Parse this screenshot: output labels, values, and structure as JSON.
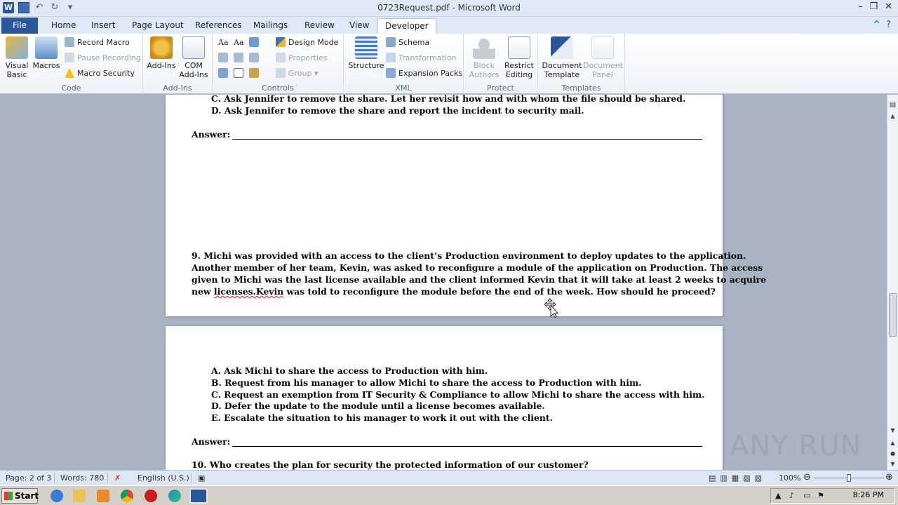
{
  "window": {
    "title": "0723Request.pdf - Microsoft Word",
    "app_icon": "W"
  },
  "tabs": [
    "File",
    "Home",
    "Insert",
    "Page Layout",
    "References",
    "Mailings",
    "Review",
    "View",
    "Developer"
  ],
  "ribbon": {
    "code": {
      "label": "Code",
      "visual_basic": "Visual Basic",
      "macros": "Macros",
      "record_macro": "Record Macro",
      "pause_recording": "Pause Recording",
      "macro_security": "Macro Security"
    },
    "addins": {
      "label": "Add-Ins",
      "add_ins": "Add-Ins",
      "com_add_ins": "COM Add-Ins"
    },
    "controls": {
      "label": "Controls",
      "design_mode": "Design Mode",
      "properties": "Properties",
      "group": "Group"
    },
    "xml": {
      "label": "XML",
      "structure": "Structure",
      "schema": "Schema",
      "transformation": "Transformation",
      "expansion_packs": "Expansion Packs"
    },
    "protect": {
      "label": "Protect",
      "block_authors": "Block Authors",
      "restrict_editing": "Restrict Editing"
    },
    "templates": {
      "label": "Templates",
      "document_template": "Document Template",
      "document_panel": "Document Panel"
    }
  },
  "document": {
    "page1": {
      "option_c": "C.  Ask Jennifer to remove the share. Let her revisit how and with whom the file should be shared.",
      "option_d": "D.  Ask Jennifer to remove the share and report the incident to security mail.",
      "answer_label": "Answer:",
      "q9_lines": [
        "9.  Michi was provided with an access to the client’s Production environment to deploy updates to the application.",
        "Another member of her team, Kevin, was asked to reconfigure a module of the application on Production. The access",
        "given to Michi was the last license available and the client informed Kevin that it will take at least 2 weeks to acquire"
      ],
      "q9_last_prefix": "new ",
      "q9_last_misspelled": "licenses.Kevin",
      "q9_last_suffix": " was told to reconfigure the module before the end of the week. How should he proceed?"
    },
    "page2": {
      "options": [
        "A.  Ask Michi to share the access to Production with him.",
        "B.  Request from his manager to allow Michi to share the access to Production with him.",
        "C.  Request an exemption from IT Security & Compliance to allow Michi to share the access with him.",
        "D.  Defer the update to the module until a license becomes available.",
        "E.  Escalate the situation to his manager to work it out with the client."
      ],
      "answer_label": "Answer:",
      "q10": "10.  Who creates the plan for security the protected information of our customer?"
    }
  },
  "statusbar": {
    "page": "Page: 2 of 3",
    "words": "Words: 780",
    "language": "English (U.S.)",
    "zoom": "100%"
  },
  "taskbar": {
    "start": "Start",
    "time": "8:26 PM"
  },
  "watermark": "ANY RUN"
}
